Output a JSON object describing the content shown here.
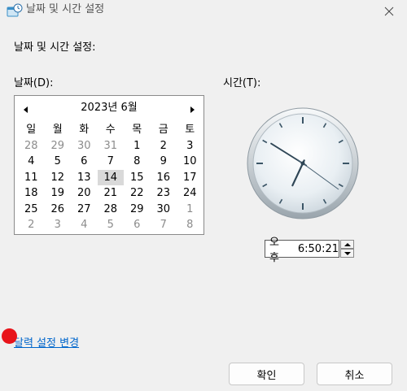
{
  "window": {
    "title": "날짜 및 시간 설정",
    "title_icon": "date-time-settings-icon",
    "close_icon": "close-icon"
  },
  "heading": "날짜 및 시간 설정:",
  "date_label": "날짜(D):",
  "time_label": "시간(T):",
  "calendar": {
    "month_title": "2023년 6월",
    "prev_icon": "triangle-left-icon",
    "next_icon": "triangle-right-icon",
    "weekdays": [
      "일",
      "월",
      "화",
      "수",
      "목",
      "금",
      "토"
    ],
    "weeks": [
      [
        {
          "d": "28",
          "o": true
        },
        {
          "d": "29",
          "o": true
        },
        {
          "d": "30",
          "o": true
        },
        {
          "d": "31",
          "o": true
        },
        {
          "d": "1"
        },
        {
          "d": "2"
        },
        {
          "d": "3"
        }
      ],
      [
        {
          "d": "4"
        },
        {
          "d": "5"
        },
        {
          "d": "6"
        },
        {
          "d": "7"
        },
        {
          "d": "8"
        },
        {
          "d": "9"
        },
        {
          "d": "10"
        }
      ],
      [
        {
          "d": "11"
        },
        {
          "d": "12"
        },
        {
          "d": "13"
        },
        {
          "d": "14",
          "sel": true
        },
        {
          "d": "15"
        },
        {
          "d": "16"
        },
        {
          "d": "17"
        }
      ],
      [
        {
          "d": "18"
        },
        {
          "d": "19"
        },
        {
          "d": "20"
        },
        {
          "d": "21"
        },
        {
          "d": "22"
        },
        {
          "d": "23"
        },
        {
          "d": "24"
        }
      ],
      [
        {
          "d": "25"
        },
        {
          "d": "26"
        },
        {
          "d": "27"
        },
        {
          "d": "28"
        },
        {
          "d": "29"
        },
        {
          "d": "30"
        },
        {
          "d": "1",
          "o": true
        }
      ],
      [
        {
          "d": "2",
          "o": true
        },
        {
          "d": "3",
          "o": true
        },
        {
          "d": "4",
          "o": true
        },
        {
          "d": "5",
          "o": true
        },
        {
          "d": "6",
          "o": true
        },
        {
          "d": "7",
          "o": true
        },
        {
          "d": "8",
          "o": true
        }
      ]
    ],
    "selected_bg": "#d9d9d9",
    "other_month_color": "#8c8c8c"
  },
  "clock": {
    "hours": 18,
    "minutes": 50,
    "seconds": 21
  },
  "time": {
    "ampm": "오후",
    "value": "6:50:21",
    "up_icon": "spin-up-icon",
    "down_icon": "spin-down-icon"
  },
  "link": {
    "label": "달력 설정 변경",
    "color": "#0066cc"
  },
  "buttons": {
    "ok": "확인",
    "cancel": "취소"
  },
  "colors": {
    "background": "#f0f0f0",
    "cursor_marker": "#e8141a"
  }
}
